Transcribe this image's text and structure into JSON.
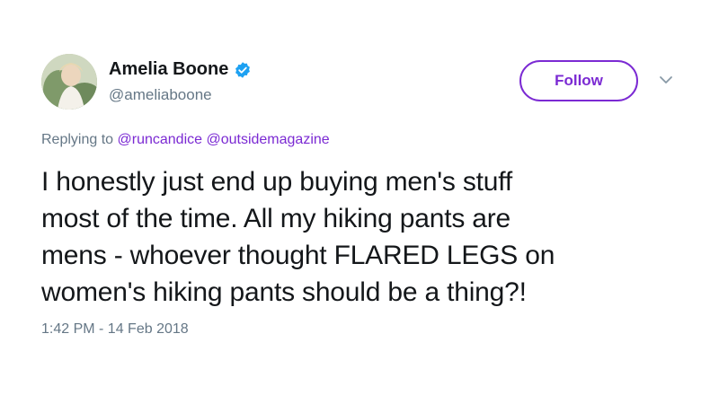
{
  "author": {
    "display_name": "Amelia Boone",
    "handle": "@ameliaboone",
    "verified_icon": "verified-badge-icon",
    "verified_color": "#1da1f2"
  },
  "actions": {
    "follow_label": "Follow",
    "follow_color": "#7b2ad3",
    "more_icon": "chevron-down-icon"
  },
  "reply": {
    "prefix": "Replying to",
    "mentions": [
      "@runcandice",
      "@outsidemagazine"
    ]
  },
  "tweet": {
    "lines": [
      "I honestly just end up buying men's stuff",
      "most of the time. All my hiking pants are",
      "mens - whoever thought FLARED LEGS on",
      "women's hiking pants should be a thing?!"
    ]
  },
  "timestamp": "1:42 PM - 14 Feb 2018"
}
